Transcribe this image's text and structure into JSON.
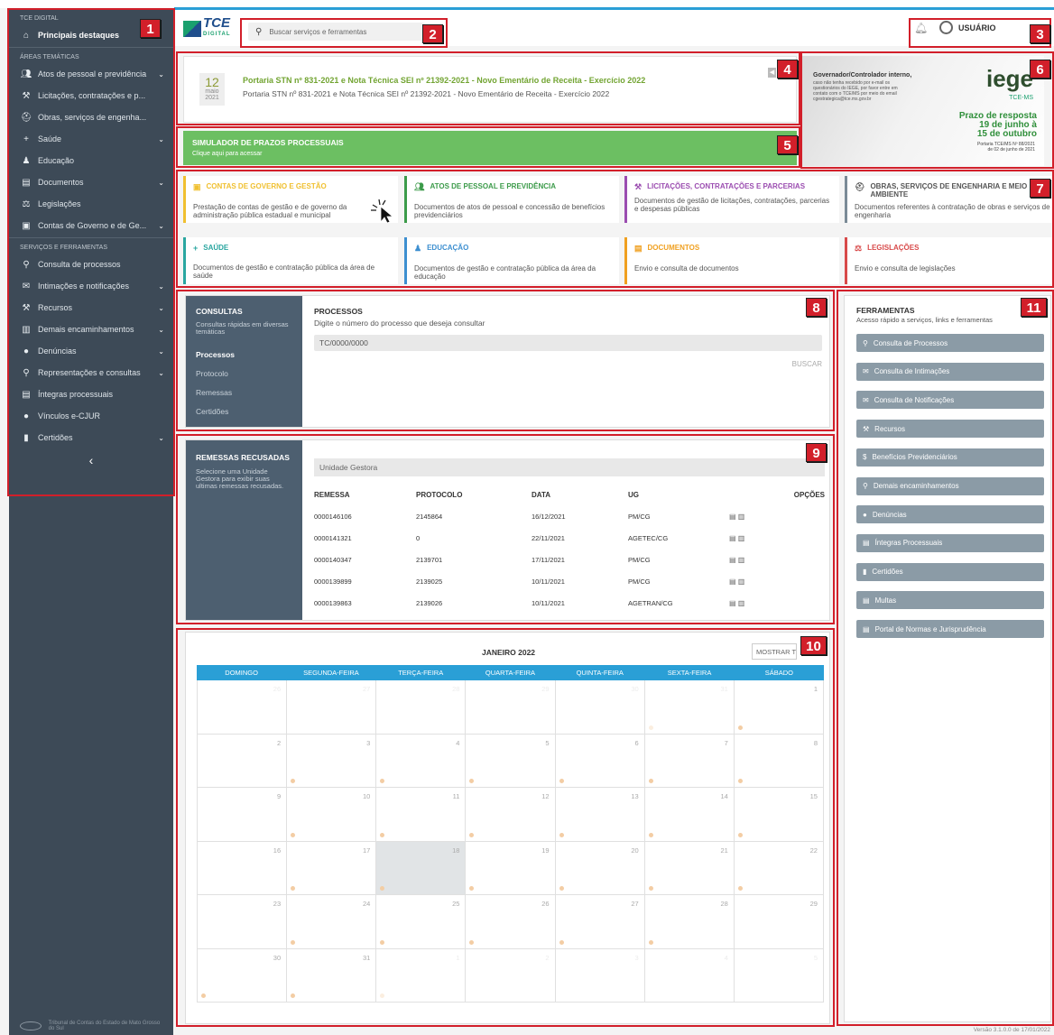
{
  "sidebar": {
    "section_top": "TCE DIGITAL",
    "highlight": "Principais destaques",
    "section_areas": "ÁREAS TEMÁTICAS",
    "areas": [
      {
        "label": "Atos de pessoal e previdência",
        "icon": "users-icon",
        "chev": "⌄"
      },
      {
        "label": "Licitações, contratações e p...",
        "icon": "gavel-icon",
        "chev": ""
      },
      {
        "label": "Obras, serviços de engenha...",
        "icon": "helmet-icon",
        "chev": ""
      },
      {
        "label": "Saúde",
        "icon": "plus-icon",
        "chev": "⌄"
      },
      {
        "label": "Educação",
        "icon": "education-icon",
        "chev": ""
      },
      {
        "label": "Documentos",
        "icon": "document-icon",
        "chev": "⌄"
      },
      {
        "label": "Legislações",
        "icon": "balance-icon",
        "chev": ""
      },
      {
        "label": "Contas de Governo e de Ge...",
        "icon": "money-icon",
        "chev": "⌄"
      }
    ],
    "section_services": "SERVIÇOS E FERRAMENTAS",
    "services": [
      {
        "label": "Consulta de processos",
        "icon": "search-icon",
        "chev": ""
      },
      {
        "label": "Intimações e notificações",
        "icon": "envelope-icon",
        "chev": "⌄"
      },
      {
        "label": "Recursos",
        "icon": "gavel-icon",
        "chev": "⌄"
      },
      {
        "label": "Demais encaminhamentos",
        "icon": "files-icon",
        "chev": "⌄"
      },
      {
        "label": "Denúncias",
        "icon": "comment-icon",
        "chev": "⌄"
      },
      {
        "label": "Representações e consultas",
        "icon": "search-icon",
        "chev": "⌄"
      },
      {
        "label": "Íntegras processuais",
        "icon": "document-icon",
        "chev": ""
      },
      {
        "label": "Vínculos e-CJUR",
        "icon": "user-icon",
        "chev": ""
      },
      {
        "label": "Certidões",
        "icon": "file-icon",
        "chev": "⌄"
      }
    ],
    "collapse": "‹",
    "footer": "Tribunal de Contas do Estado de Mato Grosso do Sul"
  },
  "header": {
    "brand": "TCE",
    "brand_sub": "DIGITAL",
    "search_placeholder": "Buscar serviços e ferramentas",
    "user": "USUÁRIO"
  },
  "news": {
    "day": "12",
    "month": "maio",
    "year": "2021",
    "title": "Portaria STN nº 831-2021 e Nota Técnica SEI nº 21392-2021 - Novo Ementário de Receita - Exercício 2022",
    "desc": "Portaria STN nº 831-2021 e Nota Técnica SEI nº 21392-2021 - Novo Ementário de Receita - Exercício 2022"
  },
  "banner": {
    "line1": "Governador/Controlador interno,",
    "line2": "caso não tenha recebido por e-mail os questionários do IEGE, por favor entre em contato com o TCE/MS por meio do email cgestrategica@tce.ms.gov.br",
    "brand": "iege",
    "brand_sub": "TCE-MS",
    "prazo1": "Prazo de resposta",
    "prazo2": "19 de junho à",
    "prazo3": "15 de outubro",
    "portaria1": "Portaria TCE/MS Nº 88/2021",
    "portaria2": "de 02 de junho de 2021"
  },
  "simulator": {
    "title": "SIMULADOR DE PRAZOS PROCESSUAIS",
    "sub": "Clique aqui para acessar"
  },
  "tiles": [
    {
      "title": "CONTAS DE GOVERNO E GESTÃO",
      "desc": "Prestação de contas de gestão e de governo da administração pública estadual e municipal",
      "color": "#f0c030",
      "icon": "money-icon"
    },
    {
      "title": "ATOS DE PESSOAL E PREVIDÊNCIA",
      "desc": "Documentos de atos de pessoal e concessão de benefícios previdenciários",
      "color": "#3c9b4a",
      "icon": "users-icon"
    },
    {
      "title": "LICITAÇÕES, CONTRATAÇÕES E PARCERIAS",
      "desc": "Documentos de gestão de licitações, contratações, parcerias e despesas públicas",
      "color": "#9b4db0",
      "icon": "gavel-icon"
    },
    {
      "title": "OBRAS, SERVIÇOS DE ENGENHARIA E MEIO AMBIENTE",
      "desc": "Documentos referentes à contratação de obras e serviços de engenharia",
      "color": "#7a8a96",
      "icon": "helmet-icon"
    },
    {
      "title": "SAÚDE",
      "desc": "Documentos de gestão e contratação pública da área de saúde",
      "color": "#2aa6a0",
      "icon": "plus-icon"
    },
    {
      "title": "EDUCAÇÃO",
      "desc": "Documentos de gestão e contratação pública da área da educação",
      "color": "#3d8fd0",
      "icon": "education-icon"
    },
    {
      "title": "DOCUMENTOS",
      "desc": "Envio e consulta de documentos",
      "color": "#f0a020",
      "icon": "document-icon"
    },
    {
      "title": "LEGISLAÇÕES",
      "desc": "Envio e consulta de legislações",
      "color": "#d84a4a",
      "icon": "balance-icon"
    }
  ],
  "consultas": {
    "title": "CONSULTAS",
    "sub": "Consultas rápidas em diversas temáticas",
    "links": [
      "Processos",
      "Protocolo",
      "Remessas",
      "Certidões"
    ],
    "main_title": "PROCESSOS",
    "main_sub": "Digite o número do processo que deseja consultar",
    "input": "TC/0000/0000",
    "button": "BUSCAR"
  },
  "remessas": {
    "title": "REMESSAS RECUSADAS",
    "sub": "Selecione uma Unidade Gestora para exibir suas ultimas remessas recusadas.",
    "select": "Unidade Gestora",
    "headers": [
      "REMESSA",
      "PROTOCOLO",
      "DATA",
      "UG",
      "",
      "OPÇÕES"
    ],
    "rows": [
      [
        "0000146106",
        "2145864",
        "16/12/2021",
        "PM/CG"
      ],
      [
        "0000141321",
        "0",
        "22/11/2021",
        "AGETEC/CG"
      ],
      [
        "0000140347",
        "2139701",
        "17/11/2021",
        "PM/CG"
      ],
      [
        "0000139899",
        "2139025",
        "10/11/2021",
        "PM/CG"
      ],
      [
        "0000139863",
        "2139026",
        "10/11/2021",
        "AGETRAN/CG"
      ]
    ]
  },
  "calendar": {
    "title": "JANEIRO 2022",
    "button": "MOSTRAR T",
    "weekdays": [
      "DOMINGO",
      "SEGUNDA-FEIRA",
      "TERÇA-FEIRA",
      "QUARTA-FEIRA",
      "QUINTA-FEIRA",
      "SEXTA-FEIRA",
      "SÁBADO"
    ],
    "weeks": [
      [
        "26",
        "27",
        "28",
        "29",
        "30",
        "31",
        "1"
      ],
      [
        "2",
        "3",
        "4",
        "5",
        "6",
        "7",
        "8"
      ],
      [
        "9",
        "10",
        "11",
        "12",
        "13",
        "14",
        "15"
      ],
      [
        "16",
        "17",
        "18",
        "19",
        "20",
        "21",
        "22"
      ],
      [
        "23",
        "24",
        "25",
        "26",
        "27",
        "28",
        "29"
      ],
      [
        "30",
        "31",
        "1",
        "2",
        "3",
        "4",
        "5"
      ]
    ]
  },
  "ferramentas": {
    "title": "FERRAMENTAS",
    "sub": "Acesso rápido a serviços, links e ferramentas",
    "buttons": [
      {
        "label": "Consulta de Processos",
        "icon": "search-icon"
      },
      {
        "label": "Consulta de Intimações",
        "icon": "envelope-icon"
      },
      {
        "label": "Consulta de Notificações",
        "icon": "envelope-icon"
      },
      {
        "label": "Recursos",
        "icon": "gavel-icon"
      },
      {
        "label": "Benefícios Previdenciários",
        "icon": "dollar-icon"
      },
      {
        "label": "Demais encaminhamentos",
        "icon": "search-icon"
      },
      {
        "label": "Denúncias",
        "icon": "comment-icon"
      },
      {
        "label": "Íntegras Processuais",
        "icon": "document-icon"
      },
      {
        "label": "Certidões",
        "icon": "file-icon"
      },
      {
        "label": "Multas",
        "icon": "document-icon"
      },
      {
        "label": "Portal de Normas e Jurisprudência",
        "icon": "document-icon"
      }
    ]
  },
  "version": "Versão 3.1.0.0 de 17/01/2022",
  "annotations": [
    "1",
    "2",
    "3",
    "4",
    "5",
    "6",
    "7",
    "8",
    "9",
    "10",
    "11"
  ]
}
